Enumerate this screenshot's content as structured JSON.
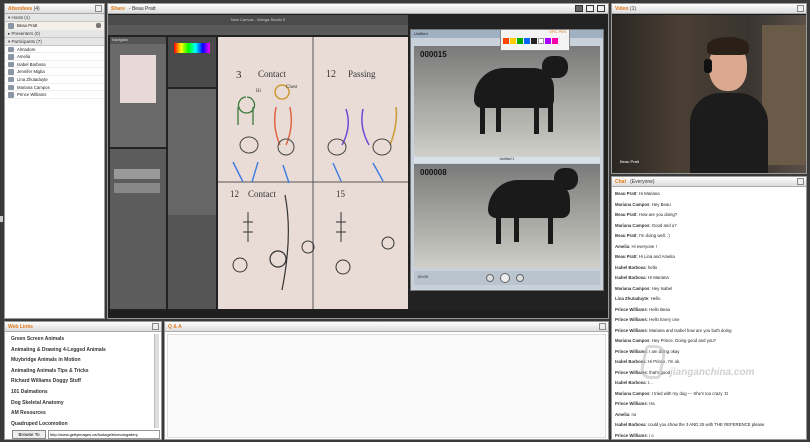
{
  "attendees": {
    "title": "Attendees",
    "count": "(4)",
    "hosts_label": "Hosts (1)",
    "hosts": [
      {
        "name": "Beau Pratt"
      }
    ],
    "presenters_label": "Presenters (0)",
    "participants_label": "Participants (7)",
    "participants": [
      {
        "name": "Almadore"
      },
      {
        "name": "Amelia"
      },
      {
        "name": "Isabel Barbosa"
      },
      {
        "name": "Jennifer Miglia"
      },
      {
        "name": "Lina Zhutaduyte"
      },
      {
        "name": "Mariana Campos"
      },
      {
        "name": "Prince Williams"
      }
    ]
  },
  "share": {
    "title": "Share",
    "presenter": "- Beau Pratt"
  },
  "app": {
    "title": "New Canvas - Manga Studio 5",
    "tabs": [
      "Navigator",
      "Sub View"
    ],
    "tool_labels": [
      "Pen",
      "Brush",
      "Brush",
      "G-pen",
      "Mapping",
      "Marker",
      "Pencil",
      "Fill",
      "Ink",
      "Soft"
    ],
    "side_labels": [
      "Color",
      "Layer",
      "Tool"
    ],
    "panel_rows": [
      "Brush Size",
      "Opacity",
      "Stabilization",
      "Ink",
      "Spacing"
    ]
  },
  "canvas": {
    "headings": [
      "3",
      "Contact",
      "12",
      "Passing",
      "12",
      "Contact",
      "15"
    ],
    "sub_labels": [
      "Hi",
      "Chest"
    ]
  },
  "video_player": {
    "title": "Untitled",
    "counter_top": "000015",
    "counter_bottom": "000008",
    "tab": "Frame 1",
    "label_top": "Untitled 1",
    "label_bottom": "Untitled 2",
    "time": "00:00"
  },
  "palette": {
    "title": "EPIC PEN",
    "colors": [
      "#f40",
      "#fc0",
      "#0a0",
      "#06f",
      "#222",
      "#fff",
      "#a0f",
      "#f0a"
    ]
  },
  "video": {
    "title": "Video",
    "count": "(1)",
    "name": "Beau Pratt"
  },
  "chat": {
    "title": "Chat",
    "audience": "(Everyone)",
    "messages": [
      {
        "from": "Beau Pratt",
        "text": "Hi Mariana"
      },
      {
        "from": "Mariana Campos",
        "text": "Hey Beau"
      },
      {
        "from": "Beau Pratt",
        "text": "How are you doing?"
      },
      {
        "from": "Mariana Campos",
        "text": "Good and u?"
      },
      {
        "from": "Beau Pratt",
        "text": "I'm doing well. :)"
      },
      {
        "from": "Amelia",
        "text": "Hi everyone !"
      },
      {
        "from": "Beau Pratt",
        "text": "Hi Lina and Amelia"
      },
      {
        "from": "Isabel Barbosa",
        "text": "hello"
      },
      {
        "from": "Isabel Barbosa",
        "text": "Hi Mariana"
      },
      {
        "from": "Mariana Campos",
        "text": "Hey Isabel"
      },
      {
        "from": "Lina Zhutaduyte",
        "text": "Hello"
      },
      {
        "from": "Prince Williams",
        "text": "Hello Beau"
      },
      {
        "from": "Prince Williams",
        "text": "Hello Every one"
      },
      {
        "from": "Prince Williams",
        "text": "Mariana and Isabel how are you both doing"
      },
      {
        "from": "Mariana Campos",
        "text": "Hey Prince. Doing good and you?"
      },
      {
        "from": "Prince Williams",
        "text": "I am doing okay"
      },
      {
        "from": "Isabel Barbosa",
        "text": "Hi Prince, I'm ok."
      },
      {
        "from": "Prince Williams",
        "text": "that's good"
      },
      {
        "from": "Isabel Barbosa",
        "text": "I..."
      },
      {
        "from": "Mariana Campos",
        "text": "I tried with my dog --- She's too crazy :D"
      },
      {
        "from": "Prince Williams",
        "text": "Ha"
      },
      {
        "from": "Amelia",
        "text": "no"
      },
      {
        "from": "Isabel Barbosa",
        "text": "could you show the 3 AND 25 with THE REFERENCE please"
      },
      {
        "from": "Prince Williams",
        "text": "i o"
      }
    ]
  },
  "weblinks": {
    "title": "Web Links",
    "items": [
      "Green Screen Animals",
      "Animating & Drawing 4-Legged Animals",
      "Muybridge Animals in Motion",
      "Animating Animals Tips & Tricks",
      "Richard Williams Doggy Stuff",
      "101 Dalmations",
      "Dog Skeletal Anatomy",
      "AM Resources",
      "Quadruped Locomotion"
    ],
    "browse_label": "Browse To",
    "url": "http://www.gettyimages.ca/footage/blcmotogallery"
  },
  "qa": {
    "title": "Q & A"
  },
  "watermark": {
    "text": "jianganchina.com"
  }
}
